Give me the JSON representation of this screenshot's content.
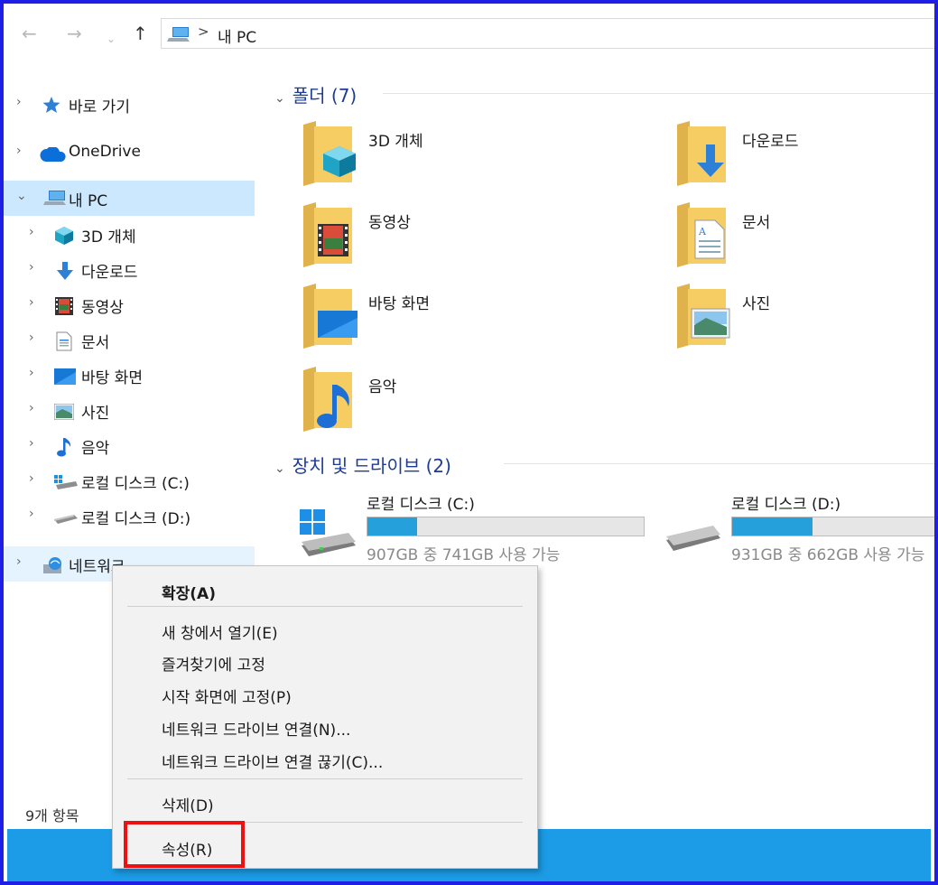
{
  "address_bar": {
    "back_glyph": "←",
    "forward_glyph": "→",
    "recent_glyph": "⌄",
    "up_glyph": "↑",
    "separator": ">",
    "path": "내 PC"
  },
  "nav_pane": {
    "quick_access": "바로 가기",
    "onedrive": "OneDrive",
    "this_pc": "내 PC",
    "objects3d": "3D 개체",
    "downloads": "다운로드",
    "videos": "동영상",
    "documents": "문서",
    "desktop": "바탕 화면",
    "pictures": "사진",
    "music": "음악",
    "drive_c": "로컬 디스크 (C:)",
    "drive_d": "로컬 디스크  (D:)",
    "network": "네트워크"
  },
  "status": {
    "item_count": "9개 항목"
  },
  "folders": {
    "header": "폴더 (7)",
    "items": [
      "3D 개체",
      "다운로드",
      "동영상",
      "문서",
      "바탕 화면",
      "사진",
      "음악"
    ]
  },
  "devices": {
    "header": "장치 및 드라이브 (2)",
    "drives": [
      {
        "name": "로컬 디스크 (C:)",
        "free_text": "907GB 중 741GB 사용 가능",
        "used_fraction": 0.18
      },
      {
        "name": "로컬 디스크  (D:)",
        "free_text": "931GB 중 662GB 사용 가능",
        "used_fraction": 0.29
      }
    ]
  },
  "context_menu": {
    "expand": "확장(A)",
    "open_new_window": "새 창에서 열기(E)",
    "pin_quick_access": "즐겨찾기에 고정",
    "pin_start": "시작 화면에 고정(P)",
    "map_drive": "네트워크 드라이브 연결(N)...",
    "disconnect_drive": "네트워크 드라이브 연결 끊기(C)...",
    "delete": "삭제(D)",
    "properties": "속성(R)"
  },
  "colors": {
    "selection": "#cce8ff",
    "hover": "#e5f3ff",
    "drive_bar": "#26a0da",
    "group_header": "#1e3c96",
    "annotation": "#ee1111",
    "frame": "#1e1ee6",
    "taskbar": "#1c9ce6"
  }
}
